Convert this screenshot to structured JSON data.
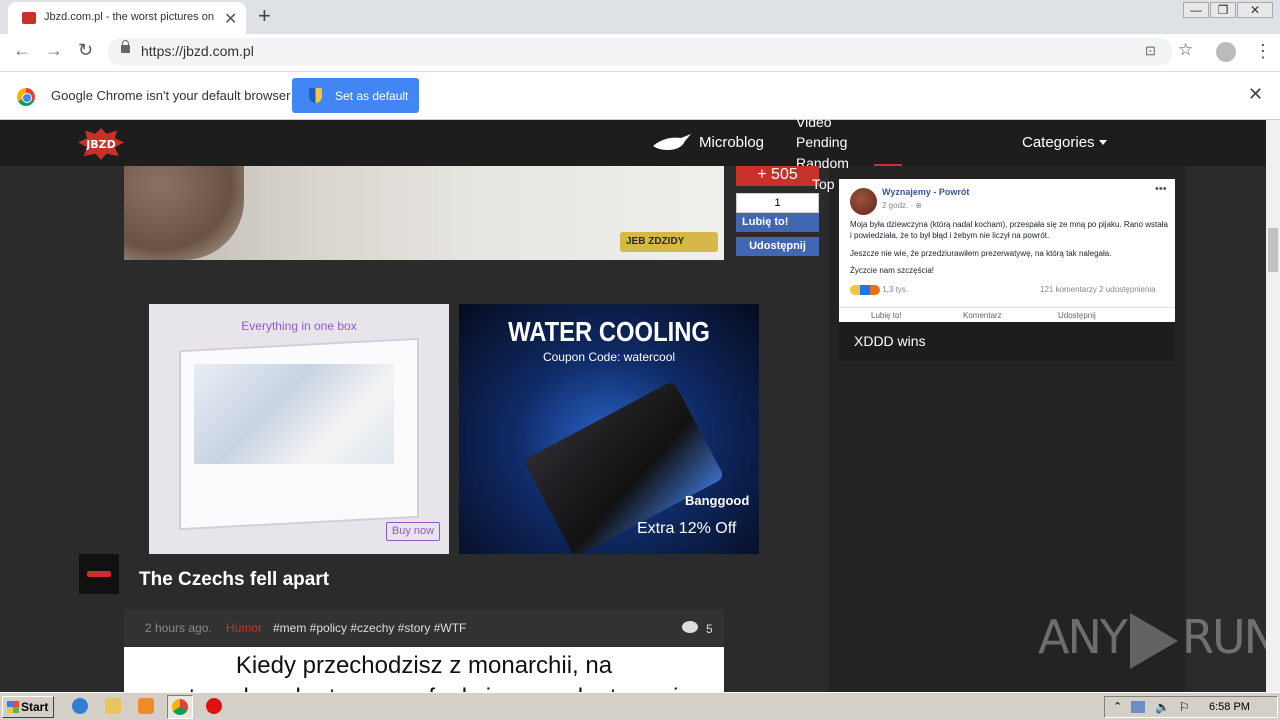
{
  "browser": {
    "tab_title": "Jbzd.com.pl - the worst pictures on",
    "tab_close": "✕",
    "new_tab": "+",
    "url": "https://jbzd.com.pl",
    "back": "←",
    "forward": "→",
    "reload": "↻",
    "translate": "⊡",
    "bookmark": "☆",
    "menu": "⋮",
    "window_buttons": [
      "—",
      "❐",
      "✕"
    ]
  },
  "infobar": {
    "message": "Google Chrome isn't your default browser",
    "button": "Set as default",
    "close": "✕"
  },
  "site": {
    "logo": "JBZD",
    "nav": {
      "microblog": "Microblog",
      "stack": [
        "Video",
        "Pending",
        "Random",
        "Top"
      ],
      "categories": "Categories"
    },
    "accent": "#c8302a"
  },
  "top_post": {
    "watermark": "JEB ZDZIDY",
    "vote": "+ 505",
    "like_count": "1",
    "like_label": "Lubię to!",
    "share_label": "Udostępnij"
  },
  "ads": {
    "left": {
      "headline": "Everything in one box",
      "button": "Buy now"
    },
    "right": {
      "headline": "WATER COOLING",
      "coupon": "Coupon Code: watercool",
      "brand": "Banggood",
      "offer": "Extra 12% Off"
    }
  },
  "post": {
    "title": "The Czechs fell apart",
    "time": "2 hours ago.",
    "category": "Humor",
    "tags": "#mem #policy #czechy #story #WTF",
    "comments": "5",
    "image_text_line1": "Kiedy przechodzisz z monarchii, na",
    "image_text_line2": "system demokratyczny, a funkcję prezydenta może pełnić"
  },
  "sidebar": {
    "fb": {
      "name": "Wyznajemy - Powrót",
      "when": "2 godz. · ⊕",
      "menu": "•••",
      "p1": "Moja była dziewczyna (którą nadal kocham), przespała się ze mną po pijaku. Rano wstała i powiedziała, że to był błąd i żebym nie liczył na powrót.",
      "p2": "Jeszcze nie wie, że przedziurawiłem prezerwatywę, na którą tak nalegała.",
      "p3": "Życzcie nam szczęścia!",
      "reactions": "1,3 tys.",
      "stats": "121 komentarzy  2 udostępnienia",
      "actions": [
        "Lubię to!",
        "Komentarz",
        "Udostępnij"
      ]
    },
    "caption": "XDDD wins"
  },
  "watermark": {
    "left": "ANY",
    "right": "RUN"
  },
  "taskbar": {
    "start": "Start",
    "clock": "6:58 PM"
  }
}
